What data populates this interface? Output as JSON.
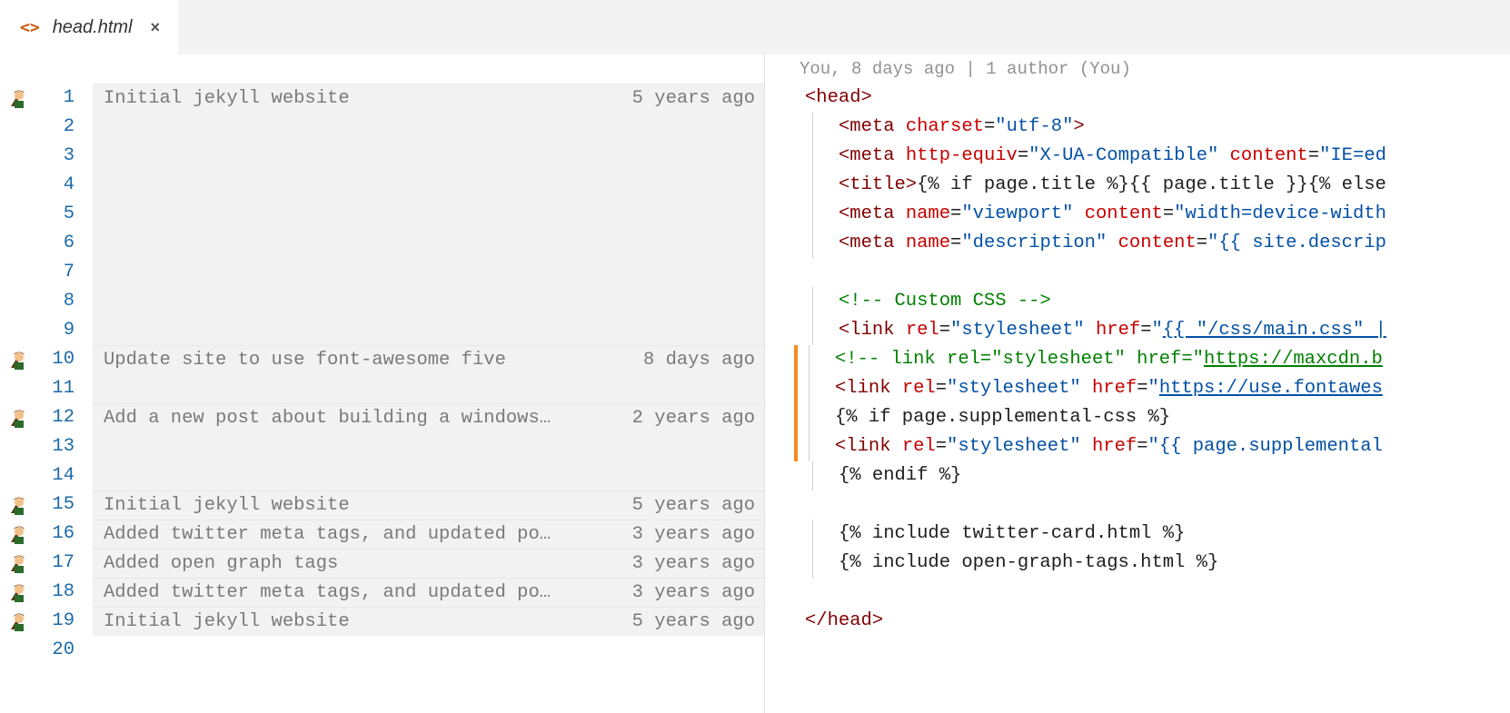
{
  "tab": {
    "icon": "<>",
    "title": "head.html"
  },
  "codelens": "You, 8 days ago | 1 author (You)",
  "line_numbers": [
    "1",
    "2",
    "3",
    "4",
    "5",
    "6",
    "7",
    "8",
    "9",
    "10",
    "11",
    "12",
    "13",
    "14",
    "15",
    "16",
    "17",
    "18",
    "19",
    "20"
  ],
  "blame": [
    {
      "avatar": true,
      "message": "Initial jekyll website",
      "age": "5 years ago",
      "continuation": false
    },
    {
      "avatar": false,
      "message": "",
      "age": "",
      "continuation": true
    },
    {
      "avatar": false,
      "message": "",
      "age": "",
      "continuation": true
    },
    {
      "avatar": false,
      "message": "",
      "age": "",
      "continuation": true
    },
    {
      "avatar": false,
      "message": "",
      "age": "",
      "continuation": true
    },
    {
      "avatar": false,
      "message": "",
      "age": "",
      "continuation": true
    },
    {
      "avatar": false,
      "message": "",
      "age": "",
      "continuation": true
    },
    {
      "avatar": false,
      "message": "",
      "age": "",
      "continuation": true
    },
    {
      "avatar": false,
      "message": "",
      "age": "",
      "continuation": true
    },
    {
      "avatar": true,
      "message": "Update site to use font-awesome five",
      "age": "8 days ago",
      "continuation": false
    },
    {
      "avatar": false,
      "message": "",
      "age": "",
      "continuation": true
    },
    {
      "avatar": true,
      "message": "Add a new post about building a windows…",
      "age": "2 years ago",
      "continuation": false
    },
    {
      "avatar": false,
      "message": "",
      "age": "",
      "continuation": true
    },
    {
      "avatar": false,
      "message": "",
      "age": "",
      "continuation": true
    },
    {
      "avatar": true,
      "message": "Initial jekyll website",
      "age": "5 years ago",
      "continuation": false
    },
    {
      "avatar": true,
      "message": "Added twitter meta tags, and updated po…",
      "age": "3 years ago",
      "continuation": false
    },
    {
      "avatar": true,
      "message": "Added open graph tags",
      "age": "3 years ago",
      "continuation": false
    },
    {
      "avatar": true,
      "message": "Added twitter meta tags, and updated po…",
      "age": "3 years ago",
      "continuation": false
    },
    {
      "avatar": true,
      "message": "Initial jekyll website",
      "age": "5 years ago",
      "continuation": false
    },
    {
      "avatar": false,
      "message": "",
      "age": "",
      "continuation": false,
      "empty": true
    }
  ],
  "code": {
    "l1": {
      "type": "tag",
      "html": "<span class='t-tag'>&lt;head&gt;</span>"
    },
    "l2": {
      "type": "meta",
      "html": "<span class='indent-guide'></span><span class='t-tag'>&lt;meta</span> <span class='t-attr'>charset</span><span class='t-txt'>=</span><span class='t-str'>\"utf-8\"</span><span class='t-tag'>&gt;</span>"
    },
    "l3": {
      "type": "meta",
      "html": "<span class='indent-guide'></span><span class='t-tag'>&lt;meta</span> <span class='t-attr'>http-equiv</span><span class='t-txt'>=</span><span class='t-str'>\"X-UA-Compatible\"</span> <span class='t-attr'>content</span><span class='t-txt'>=</span><span class='t-str'>\"IE=ed</span>"
    },
    "l4": {
      "type": "title",
      "html": "<span class='indent-guide'></span><span class='t-tag'>&lt;title&gt;</span><span class='t-liq'>{% if page.title %}{{ page.title }}{% else</span>"
    },
    "l5": {
      "type": "meta",
      "html": "<span class='indent-guide'></span><span class='t-tag'>&lt;meta</span> <span class='t-attr'>name</span><span class='t-txt'>=</span><span class='t-str'>\"viewport\"</span> <span class='t-attr'>content</span><span class='t-txt'>=</span><span class='t-str'>\"width=device-width</span>"
    },
    "l6": {
      "type": "meta",
      "html": "<span class='indent-guide'></span><span class='t-tag'>&lt;meta</span> <span class='t-attr'>name</span><span class='t-txt'>=</span><span class='t-str'>\"description\"</span> <span class='t-attr'>content</span><span class='t-txt'>=</span><span class='t-str'>\"{{ site.descrip</span>"
    },
    "l7": {
      "type": "blank",
      "html": ""
    },
    "l8": {
      "type": "comment",
      "html": "<span class='indent-guide'></span><span class='t-cmt'>&lt;!-- Custom CSS --&gt;</span>"
    },
    "l9": {
      "type": "link",
      "html": "<span class='indent-guide'></span><span class='t-tag'>&lt;link</span> <span class='t-attr'>rel</span><span class='t-txt'>=</span><span class='t-str'>\"stylesheet\"</span> <span class='t-attr'>href</span><span class='t-txt'>=</span><span class='t-str'>\"</span><span class='t-link'>{{ \"/css/main.css\" |</span>"
    },
    "l10": {
      "type": "comment",
      "html": "<span class='indent-guide'></span><span class='t-cmt'>&lt;!-- link rel=\"stylesheet\" href=\"</span><span class='t-link' style='color:#008000'>https://maxcdn.b</span>"
    },
    "l11": {
      "type": "link",
      "html": "<span class='indent-guide'></span><span class='t-tag'>&lt;link</span> <span class='t-attr'>rel</span><span class='t-txt'>=</span><span class='t-str'>\"stylesheet\"</span> <span class='t-attr'>href</span><span class='t-txt'>=</span><span class='t-str'>\"</span><span class='t-link'>https://use.fontawes</span>"
    },
    "l12": {
      "type": "liquid",
      "html": "<span class='indent-guide'></span><span class='t-liq'>{% if page.supplemental-css %}</span>"
    },
    "l13": {
      "type": "link",
      "html": "<span class='indent-guide'></span><span class='t-tag'>&lt;link</span> <span class='t-attr'>rel</span><span class='t-txt'>=</span><span class='t-str'>\"stylesheet\"</span> <span class='t-attr'>href</span><span class='t-txt'>=</span><span class='t-str'>\"{{ page.supplemental</span>"
    },
    "l14": {
      "type": "liquid",
      "html": "<span class='indent-guide'></span><span class='t-liq'>{% endif %}</span>"
    },
    "l15": {
      "type": "blank",
      "html": ""
    },
    "l16": {
      "type": "liquid",
      "html": "<span class='indent-guide'></span><span class='t-liq'>{% include twitter-card.html %}</span>"
    },
    "l17": {
      "type": "liquid",
      "html": "<span class='indent-guide'></span><span class='t-liq'>{% include open-graph-tags.html %}</span>"
    },
    "l18": {
      "type": "blank",
      "html": ""
    },
    "l19": {
      "type": "tag",
      "html": "<span class='t-tag'>&lt;/head&gt;</span>"
    },
    "l20": {
      "type": "blank",
      "html": ""
    }
  },
  "mod_bar_lines": [
    10,
    11,
    12,
    13
  ]
}
